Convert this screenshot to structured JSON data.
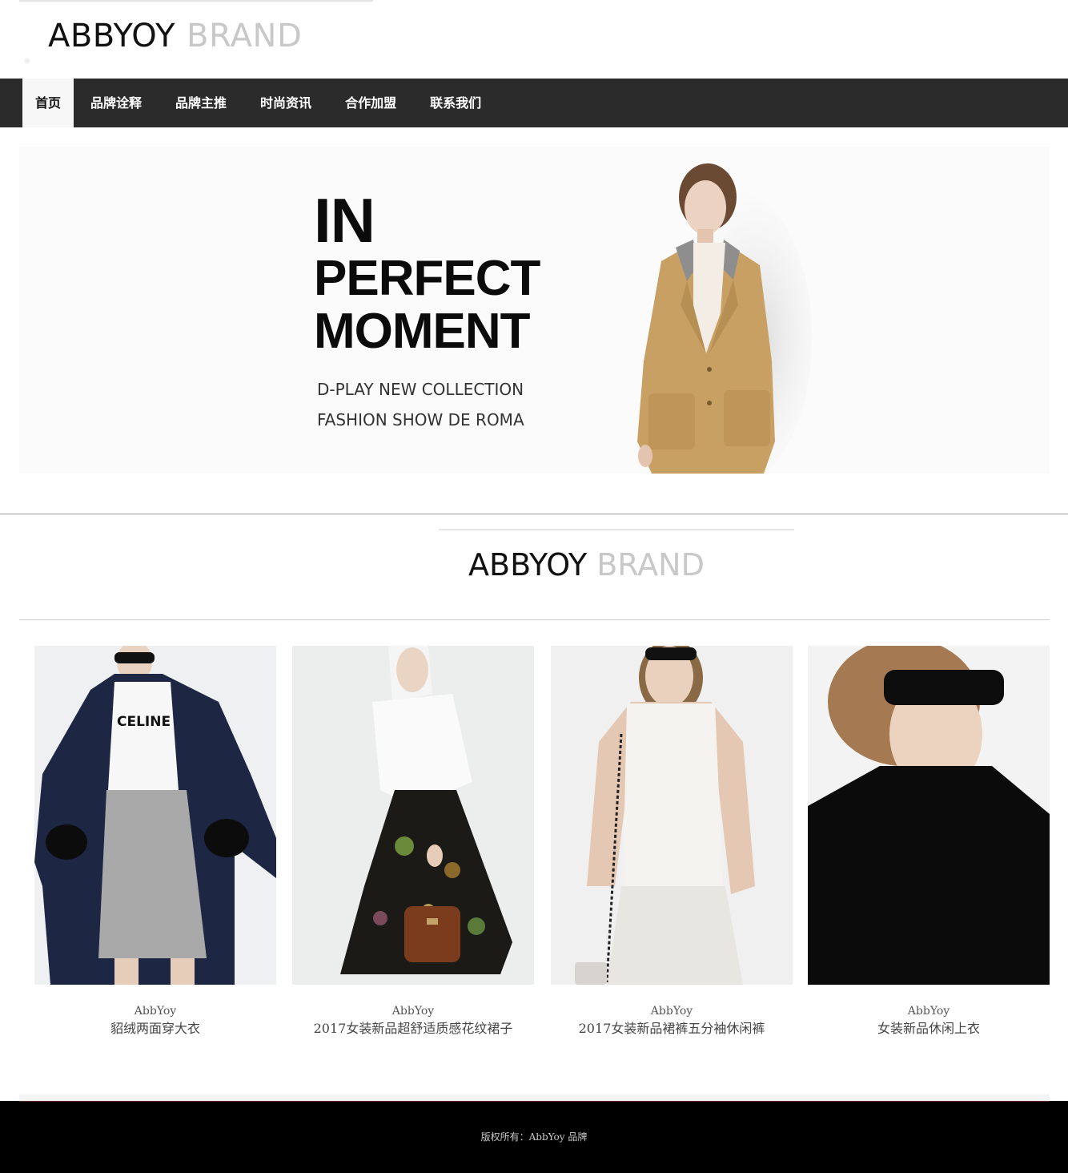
{
  "header": {
    "logo_dark": "ABBYOY",
    "logo_light": "BRAND"
  },
  "nav": {
    "items": [
      {
        "label": "首页",
        "active": true
      },
      {
        "label": "品牌诠释"
      },
      {
        "label": "品牌主推"
      },
      {
        "label": "时尚资讯"
      },
      {
        "label": "合作加盟"
      },
      {
        "label": "联系我们"
      }
    ]
  },
  "banner": {
    "line1": "IN",
    "line2": "PERFECT",
    "line3": "MOMENT",
    "sub1": "D-PLAY NEW COLLECTION",
    "sub2": "FASHION SHOW DE ROMA"
  },
  "brand_section": {
    "dark": "ABBYOY",
    "light": "BRAND"
  },
  "products": [
    {
      "brand": "AbbYoy",
      "name": "貂绒两面穿大衣"
    },
    {
      "brand": "AbbYoy",
      "name": "2017女装新品超舒适质感花纹裙子"
    },
    {
      "brand": "AbbYoy",
      "name": "2017女装新品裙裤五分袖休闲裤"
    },
    {
      "brand": "AbbYoy",
      "name": "女装新品休闲上衣"
    }
  ],
  "footer": {
    "copyright": "版权所有：AbbYoy 品牌"
  },
  "colors": {
    "nav_bg": "#2b2b2b",
    "footer_bg": "#000000",
    "brand_light": "#c8c8c8"
  }
}
